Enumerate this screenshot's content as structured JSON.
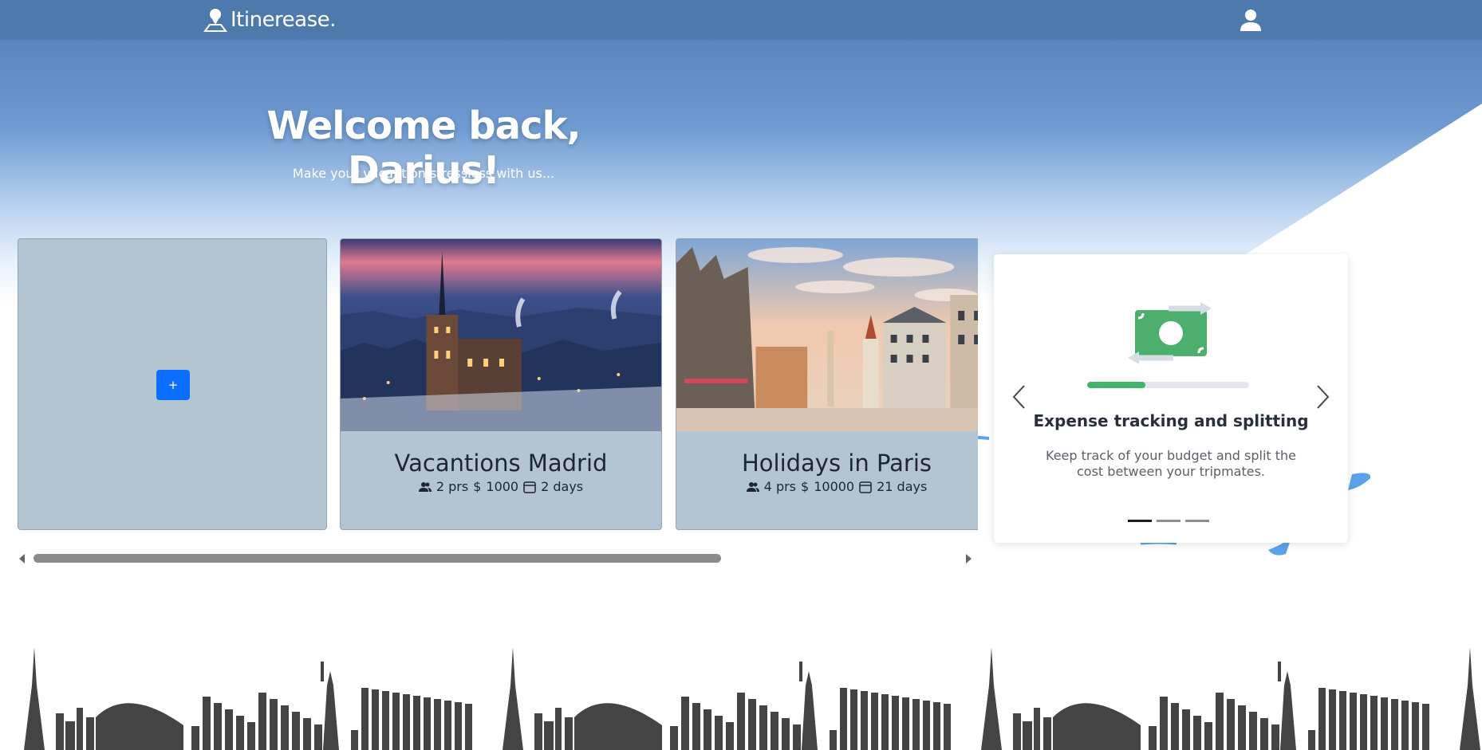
{
  "app": {
    "brand": "Itinerease.",
    "icons": {
      "logo": "map-pin-person-icon",
      "user": "user-icon"
    },
    "colors": {
      "topbar": "#4e79ad",
      "primary": "#0b6efd",
      "accent_green": "#41b36a"
    }
  },
  "hero": {
    "welcome": "Welcome back, Darius!",
    "subtitle": "Make your vacantion stressless with us..."
  },
  "trips": {
    "add_button_label": "+",
    "cards": [
      {
        "title": "Vacantions Madrid",
        "people": "2 prs",
        "currency": "$",
        "budget": "1000",
        "duration": "2 days"
      },
      {
        "title": "Holidays in Paris",
        "people": "4 prs",
        "currency": "$",
        "budget": "10000",
        "duration": "21 days"
      }
    ]
  },
  "feature_carousel": {
    "title": "Expense tracking and splitting",
    "description": "Keep track of your budget and split the cost between your tripmates.",
    "progress": 0.36,
    "active_slide": 1,
    "slide_count": 3
  }
}
